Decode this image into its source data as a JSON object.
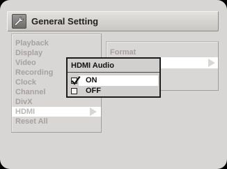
{
  "window": {
    "title": "General Setting",
    "title_icon": "wrench-icon"
  },
  "menu": {
    "items": [
      {
        "label": "Playback",
        "selected": false
      },
      {
        "label": "Display",
        "selected": false
      },
      {
        "label": "Video",
        "selected": false
      },
      {
        "label": "Recording",
        "selected": false
      },
      {
        "label": "Clock",
        "selected": false
      },
      {
        "label": "Channel",
        "selected": false
      },
      {
        "label": "DivX",
        "selected": false
      },
      {
        "label": "HDMI",
        "selected": true
      },
      {
        "label": "Reset All",
        "selected": false
      }
    ]
  },
  "submenu": {
    "items": [
      {
        "label": "Format"
      },
      {
        "label": ""
      }
    ]
  },
  "popup": {
    "title": "HDMI Audio",
    "options": [
      {
        "label": "ON",
        "checked": true,
        "highlighted": true
      },
      {
        "label": "OFF",
        "checked": false,
        "highlighted": false
      }
    ]
  },
  "colors": {
    "background": "#d8d6d4",
    "highlight": "#ffffff",
    "disabled_text": "#a4a19e",
    "active_text": "#111111"
  }
}
